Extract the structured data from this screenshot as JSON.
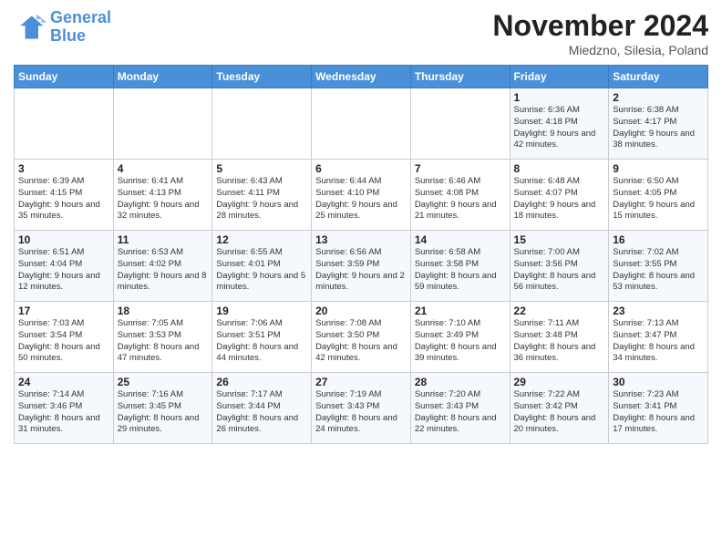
{
  "header": {
    "logo_line1": "General",
    "logo_line2": "Blue",
    "month": "November 2024",
    "location": "Miedzno, Silesia, Poland"
  },
  "days_of_week": [
    "Sunday",
    "Monday",
    "Tuesday",
    "Wednesday",
    "Thursday",
    "Friday",
    "Saturday"
  ],
  "weeks": [
    [
      {
        "day": "",
        "info": ""
      },
      {
        "day": "",
        "info": ""
      },
      {
        "day": "",
        "info": ""
      },
      {
        "day": "",
        "info": ""
      },
      {
        "day": "",
        "info": ""
      },
      {
        "day": "1",
        "info": "Sunrise: 6:36 AM\nSunset: 4:18 PM\nDaylight: 9 hours\nand 42 minutes."
      },
      {
        "day": "2",
        "info": "Sunrise: 6:38 AM\nSunset: 4:17 PM\nDaylight: 9 hours\nand 38 minutes."
      }
    ],
    [
      {
        "day": "3",
        "info": "Sunrise: 6:39 AM\nSunset: 4:15 PM\nDaylight: 9 hours\nand 35 minutes."
      },
      {
        "day": "4",
        "info": "Sunrise: 6:41 AM\nSunset: 4:13 PM\nDaylight: 9 hours\nand 32 minutes."
      },
      {
        "day": "5",
        "info": "Sunrise: 6:43 AM\nSunset: 4:11 PM\nDaylight: 9 hours\nand 28 minutes."
      },
      {
        "day": "6",
        "info": "Sunrise: 6:44 AM\nSunset: 4:10 PM\nDaylight: 9 hours\nand 25 minutes."
      },
      {
        "day": "7",
        "info": "Sunrise: 6:46 AM\nSunset: 4:08 PM\nDaylight: 9 hours\nand 21 minutes."
      },
      {
        "day": "8",
        "info": "Sunrise: 6:48 AM\nSunset: 4:07 PM\nDaylight: 9 hours\nand 18 minutes."
      },
      {
        "day": "9",
        "info": "Sunrise: 6:50 AM\nSunset: 4:05 PM\nDaylight: 9 hours\nand 15 minutes."
      }
    ],
    [
      {
        "day": "10",
        "info": "Sunrise: 6:51 AM\nSunset: 4:04 PM\nDaylight: 9 hours\nand 12 minutes."
      },
      {
        "day": "11",
        "info": "Sunrise: 6:53 AM\nSunset: 4:02 PM\nDaylight: 9 hours\nand 8 minutes."
      },
      {
        "day": "12",
        "info": "Sunrise: 6:55 AM\nSunset: 4:01 PM\nDaylight: 9 hours\nand 5 minutes."
      },
      {
        "day": "13",
        "info": "Sunrise: 6:56 AM\nSunset: 3:59 PM\nDaylight: 9 hours\nand 2 minutes."
      },
      {
        "day": "14",
        "info": "Sunrise: 6:58 AM\nSunset: 3:58 PM\nDaylight: 8 hours\nand 59 minutes."
      },
      {
        "day": "15",
        "info": "Sunrise: 7:00 AM\nSunset: 3:56 PM\nDaylight: 8 hours\nand 56 minutes."
      },
      {
        "day": "16",
        "info": "Sunrise: 7:02 AM\nSunset: 3:55 PM\nDaylight: 8 hours\nand 53 minutes."
      }
    ],
    [
      {
        "day": "17",
        "info": "Sunrise: 7:03 AM\nSunset: 3:54 PM\nDaylight: 8 hours\nand 50 minutes."
      },
      {
        "day": "18",
        "info": "Sunrise: 7:05 AM\nSunset: 3:53 PM\nDaylight: 8 hours\nand 47 minutes."
      },
      {
        "day": "19",
        "info": "Sunrise: 7:06 AM\nSunset: 3:51 PM\nDaylight: 8 hours\nand 44 minutes."
      },
      {
        "day": "20",
        "info": "Sunrise: 7:08 AM\nSunset: 3:50 PM\nDaylight: 8 hours\nand 42 minutes."
      },
      {
        "day": "21",
        "info": "Sunrise: 7:10 AM\nSunset: 3:49 PM\nDaylight: 8 hours\nand 39 minutes."
      },
      {
        "day": "22",
        "info": "Sunrise: 7:11 AM\nSunset: 3:48 PM\nDaylight: 8 hours\nand 36 minutes."
      },
      {
        "day": "23",
        "info": "Sunrise: 7:13 AM\nSunset: 3:47 PM\nDaylight: 8 hours\nand 34 minutes."
      }
    ],
    [
      {
        "day": "24",
        "info": "Sunrise: 7:14 AM\nSunset: 3:46 PM\nDaylight: 8 hours\nand 31 minutes."
      },
      {
        "day": "25",
        "info": "Sunrise: 7:16 AM\nSunset: 3:45 PM\nDaylight: 8 hours\nand 29 minutes."
      },
      {
        "day": "26",
        "info": "Sunrise: 7:17 AM\nSunset: 3:44 PM\nDaylight: 8 hours\nand 26 minutes."
      },
      {
        "day": "27",
        "info": "Sunrise: 7:19 AM\nSunset: 3:43 PM\nDaylight: 8 hours\nand 24 minutes."
      },
      {
        "day": "28",
        "info": "Sunrise: 7:20 AM\nSunset: 3:43 PM\nDaylight: 8 hours\nand 22 minutes."
      },
      {
        "day": "29",
        "info": "Sunrise: 7:22 AM\nSunset: 3:42 PM\nDaylight: 8 hours\nand 20 minutes."
      },
      {
        "day": "30",
        "info": "Sunrise: 7:23 AM\nSunset: 3:41 PM\nDaylight: 8 hours\nand 17 minutes."
      }
    ]
  ]
}
